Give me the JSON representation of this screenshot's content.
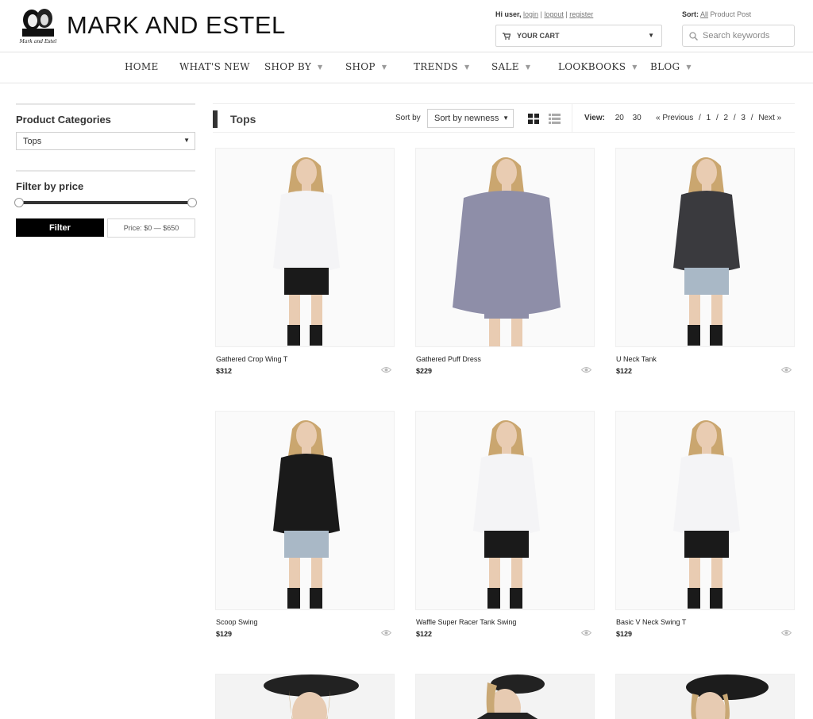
{
  "brand": {
    "name": "MARK AND ESTEL"
  },
  "header": {
    "greeting": "Hi user,",
    "login": "login",
    "logout": "logout",
    "register": "register",
    "cart_label": "YOUR CART",
    "sort_label": "Sort:",
    "sort_all": "All",
    "sort_product": "Product",
    "sort_post": "Post",
    "search_placeholder": "Search keywords"
  },
  "nav": {
    "items": [
      {
        "label": "HOME",
        "caret": false
      },
      {
        "label": "WHAT'S NEW",
        "caret": false
      },
      {
        "label": "SHOP BY",
        "caret": true
      },
      {
        "label": "SHOP",
        "caret": true
      },
      {
        "label": "TRENDS",
        "caret": true
      },
      {
        "label": "SALE",
        "caret": true
      },
      {
        "label": "LOOKBOOKS",
        "caret": true
      },
      {
        "label": "BLOG",
        "caret": true
      }
    ]
  },
  "sidebar": {
    "categories_title": "Product Categories",
    "category_selected": "Tops",
    "price_title": "Filter by price",
    "filter_button": "Filter",
    "price_range": "Price: $0 — $650",
    "price_min_fraction": 0,
    "price_max_fraction": 1
  },
  "toolbar": {
    "title": "Tops",
    "sort_by_label": "Sort by",
    "sort_selected": "Sort by newness",
    "view_label": "View:",
    "view_20": "20",
    "view_30": "30",
    "prev": "« Previous",
    "sep": "/",
    "page_1": "1",
    "page_2": "2",
    "page_3": "3",
    "next": "Next »"
  },
  "products": [
    {
      "name": "Gathered Crop Wing T",
      "price": "$312",
      "top": "white",
      "bottom": "black"
    },
    {
      "name": "Gathered Puff Dress",
      "price": "$229",
      "top": "lavender",
      "bottom": "lavender"
    },
    {
      "name": "U Neck Tank",
      "price": "$122",
      "top": "charcoal",
      "bottom": "denim"
    },
    {
      "name": "Scoop Swing",
      "price": "$129",
      "top": "black",
      "bottom": "denim"
    },
    {
      "name": "Waffle Super Racer Tank Swing",
      "price": "$122",
      "top": "white",
      "bottom": "black"
    },
    {
      "name": "Basic V Neck Swing T",
      "price": "$129",
      "top": "white",
      "bottom": "black"
    }
  ],
  "colors": {
    "accent": "#000000",
    "nav_caret": "#999999",
    "border": "#e2e2e2"
  }
}
